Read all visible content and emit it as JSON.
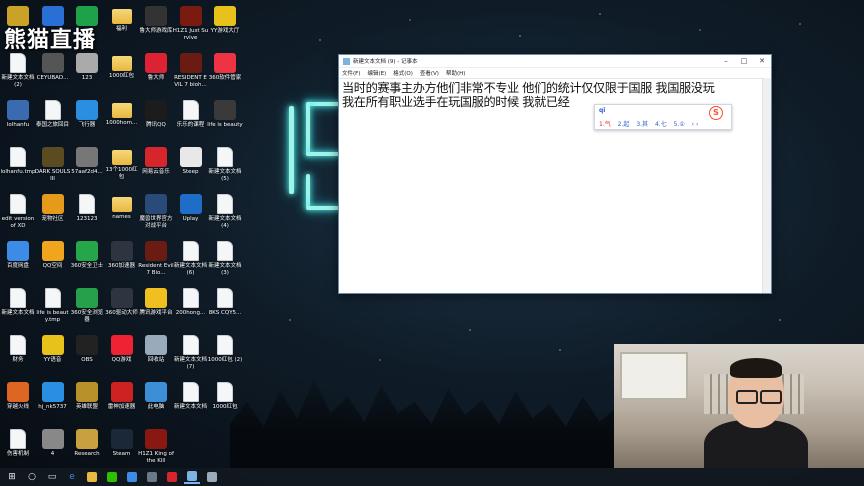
{
  "watermark": "熊猫直播",
  "colors": {
    "accent": "#7ab3ff",
    "neon": "#9ff4e8",
    "ime_accent": "#2b5fc8",
    "sogou": "#ff4b2b"
  },
  "desktop_icons": [
    {
      "label": "",
      "type": "app",
      "color": "#c9a227",
      "name": "panda-app-icon"
    },
    {
      "label": "",
      "type": "app",
      "color": "#2a6fd6",
      "name": "app-icon"
    },
    {
      "label": "",
      "type": "app",
      "color": "#1fa04b",
      "name": "app-icon"
    },
    {
      "label": "福利",
      "type": "folder",
      "color": "#e8b840",
      "name": "folder-icon"
    },
    {
      "label": "鲁大师游戏库",
      "type": "app",
      "color": "#333",
      "name": "gamepad-icon"
    },
    {
      "label": "H1Z1 Just Survive",
      "type": "app",
      "color": "#7a1a10",
      "name": "h1z1-icon"
    },
    {
      "label": "YY游戏大厅",
      "type": "app",
      "color": "#e6c21a",
      "name": "yy-icon"
    },
    {
      "label": "新建文本文档 (2)",
      "type": "file",
      "color": "#fff",
      "name": "text-file-icon"
    },
    {
      "label": "CEYUBAD...",
      "type": "app",
      "color": "#555",
      "name": "app-icon"
    },
    {
      "label": "123",
      "type": "app",
      "color": "#aaa",
      "name": "app-icon"
    },
    {
      "label": "1000红包",
      "type": "folder",
      "color": "#e8b840",
      "name": "folder-icon"
    },
    {
      "label": "鲁大师",
      "type": "app",
      "color": "#d23",
      "name": "app-icon"
    },
    {
      "label": "RESIDENT EVIL 7 bioh...",
      "type": "app",
      "color": "#6a1b12",
      "name": "re7-icon"
    },
    {
      "label": "360软件管家",
      "type": "app",
      "color": "#e34",
      "name": "app-icon"
    },
    {
      "label": "lolhanfu",
      "type": "app",
      "color": "#3a6bb0",
      "name": "app-icon"
    },
    {
      "label": "泰国之旅回目",
      "type": "file",
      "color": "#fff",
      "name": "text-file-icon"
    },
    {
      "label": "飞行器",
      "type": "app",
      "color": "#2a8fe0",
      "name": "app-icon"
    },
    {
      "label": "1000hom...",
      "type": "folder",
      "color": "#e8b840",
      "name": "folder-icon"
    },
    {
      "label": "腾讯QQ",
      "type": "app",
      "color": "#1c1c1c",
      "name": "qq-icon"
    },
    {
      "label": "乐乐的课程",
      "type": "file",
      "color": "#fff",
      "name": "text-file-icon"
    },
    {
      "label": "life is beauty",
      "type": "app",
      "color": "#3a3a3a",
      "name": "app-icon"
    },
    {
      "label": "lolhanfu.tmp",
      "type": "file",
      "color": "#fff",
      "name": "text-file-icon"
    },
    {
      "label": "DARK SOULS III",
      "type": "app",
      "color": "#5a4b20",
      "name": "app-icon"
    },
    {
      "label": "57aaf2d4...",
      "type": "app",
      "color": "#777",
      "name": "app-icon"
    },
    {
      "label": "13个1000红包",
      "type": "folder",
      "color": "#e8b840",
      "name": "folder-icon"
    },
    {
      "label": "网易云音乐",
      "type": "app",
      "color": "#d6252b",
      "name": "netease-icon"
    },
    {
      "label": "Steep",
      "type": "app",
      "color": "#e8e8e8",
      "name": "steep-icon"
    },
    {
      "label": "新建文本文档 (5)",
      "type": "file",
      "color": "#fff",
      "name": "text-file-icon"
    },
    {
      "label": "edit version of XD",
      "type": "file",
      "color": "#fff",
      "name": "text-file-icon"
    },
    {
      "label": "宠物社区",
      "type": "app",
      "color": "#e59a1c",
      "name": "app-icon"
    },
    {
      "label": "123123",
      "type": "file",
      "color": "#fff",
      "name": "text-file-icon"
    },
    {
      "label": "names",
      "type": "folder",
      "color": "#e8b840",
      "name": "folder-icon"
    },
    {
      "label": "魔兽世界官方对战平台",
      "type": "app",
      "color": "#2a4a7a",
      "name": "app-icon"
    },
    {
      "label": "Uplay",
      "type": "app",
      "color": "#1e6ec8",
      "name": "uplay-icon"
    },
    {
      "label": "新建文本文档 (4)",
      "type": "file",
      "color": "#fff",
      "name": "text-file-icon"
    },
    {
      "label": "百度网盘",
      "type": "app",
      "color": "#3c8be6",
      "name": "app-icon"
    },
    {
      "label": "QQ空间",
      "type": "app",
      "color": "#f0a51c",
      "name": "app-icon"
    },
    {
      "label": "360安全卫士",
      "type": "app",
      "color": "#25a648",
      "name": "app-icon"
    },
    {
      "label": "360加速器",
      "type": "app",
      "color": "#2e3440",
      "name": "app-icon"
    },
    {
      "label": "Resident Evil 7 Bio...",
      "type": "app",
      "color": "#6a1b12",
      "name": "app-icon"
    },
    {
      "label": "新建文本文档 (6)",
      "type": "file",
      "color": "#fff",
      "name": "text-file-icon"
    },
    {
      "label": "新建文本文档 (3)",
      "type": "file",
      "color": "#fff",
      "name": "text-file-icon"
    },
    {
      "label": "新建文本文档",
      "type": "file",
      "color": "#fff",
      "name": "text-file-icon"
    },
    {
      "label": "life is beauty.tmp",
      "type": "file",
      "color": "#fff",
      "name": "text-file-icon"
    },
    {
      "label": "360安全浏览器",
      "type": "app",
      "color": "#26a04a",
      "name": "app-icon"
    },
    {
      "label": "360驱动大师",
      "type": "app",
      "color": "#2e3440",
      "name": "app-icon"
    },
    {
      "label": "腾讯游戏平台",
      "type": "app",
      "color": "#f0c020",
      "name": "app-icon"
    },
    {
      "label": "200hong...",
      "type": "file",
      "color": "#fff",
      "name": "text-file-icon"
    },
    {
      "label": "8KS CQY5...",
      "type": "file",
      "color": "#fff",
      "name": "text-file-icon"
    },
    {
      "label": "财务",
      "type": "file",
      "color": "#fff",
      "name": "text-file-icon"
    },
    {
      "label": "YY语音",
      "type": "app",
      "color": "#e6c21a",
      "name": "app-icon"
    },
    {
      "label": "OBS",
      "type": "app",
      "color": "#222",
      "name": "obs-icon"
    },
    {
      "label": "QQ游戏",
      "type": "app",
      "color": "#e23",
      "name": "app-icon"
    },
    {
      "label": "回收站",
      "type": "app",
      "color": "#9ab",
      "name": "recycle-bin-icon"
    },
    {
      "label": "新建文本文档 (7)",
      "type": "file",
      "color": "#fff",
      "name": "text-file-icon"
    },
    {
      "label": "1000红包 (2)",
      "type": "file",
      "color": "#fff",
      "name": "text-file-icon"
    },
    {
      "label": "穿越火线",
      "type": "app",
      "color": "#d62",
      "name": "app-icon"
    },
    {
      "label": "hj_nk5737",
      "type": "app",
      "color": "#2a8fe0",
      "name": "app-icon"
    },
    {
      "label": "英雄联盟",
      "type": "app",
      "color": "#b8912a",
      "name": "app-icon"
    },
    {
      "label": "雷神加速器",
      "type": "app",
      "color": "#c22",
      "name": "app-icon"
    },
    {
      "label": "此电脑",
      "type": "app",
      "color": "#3a8fd6",
      "name": "this-pc-icon"
    },
    {
      "label": "新建文本文档",
      "type": "file",
      "color": "#fff",
      "name": "text-file-icon"
    },
    {
      "label": "1000红包",
      "type": "file",
      "color": "#fff",
      "name": "text-file-icon"
    },
    {
      "label": "伤害机制",
      "type": "file",
      "color": "#fff",
      "name": "text-file-icon"
    },
    {
      "label": "4",
      "type": "app",
      "color": "#888",
      "name": "app-icon"
    },
    {
      "label": "Research",
      "type": "app",
      "color": "#c8a040",
      "name": "app-icon"
    },
    {
      "label": "Steam",
      "type": "app",
      "color": "#1b2838",
      "name": "steam-icon"
    },
    {
      "label": "H1Z1 King of the Kill",
      "type": "app",
      "color": "#8a1812",
      "name": "h1z1-icon"
    }
  ],
  "notepad": {
    "title": "新建文本文档 (9) - 记事本",
    "menu": [
      "文件(F)",
      "编辑(E)",
      "格式(O)",
      "查看(V)",
      "帮助(H)"
    ],
    "lines": [
      "当时的赛事主办方他们非常不专业  他们的统计仅仅限于国服  我国服没玩",
      "我在所有职业选手在玩国服的时候  我就已经"
    ]
  },
  "ime": {
    "composition": "qi",
    "candidates": [
      "1.气",
      "2.起",
      "3.其",
      "4.七",
      "5.①"
    ],
    "logo": "S",
    "nav": "‹ ›"
  },
  "taskbar": {
    "items": [
      {
        "name": "windows-start-icon",
        "glyph": "⊞",
        "color": "#e9eef5"
      },
      {
        "name": "search-icon",
        "glyph": "○",
        "color": "#e9eef5"
      },
      {
        "name": "task-view-icon",
        "glyph": "▭",
        "color": "#e9eef5"
      },
      {
        "name": "edge-icon",
        "glyph": "e",
        "color": "#3c8be6"
      },
      {
        "name": "file-explorer-icon",
        "glyph": "",
        "color": "#e8b840"
      },
      {
        "name": "wechat-icon",
        "glyph": "",
        "color": "#2dc100"
      },
      {
        "name": "store-icon",
        "glyph": "",
        "color": "#3c8be6"
      },
      {
        "name": "app-icon",
        "glyph": "",
        "color": "#6a7a88"
      },
      {
        "name": "netease-icon",
        "glyph": "",
        "color": "#d6252b"
      },
      {
        "name": "notepad-icon",
        "glyph": "",
        "color": "#7cb3e0"
      },
      {
        "name": "app-icon",
        "glyph": "",
        "color": "#9ab"
      }
    ],
    "active_index": 9
  }
}
